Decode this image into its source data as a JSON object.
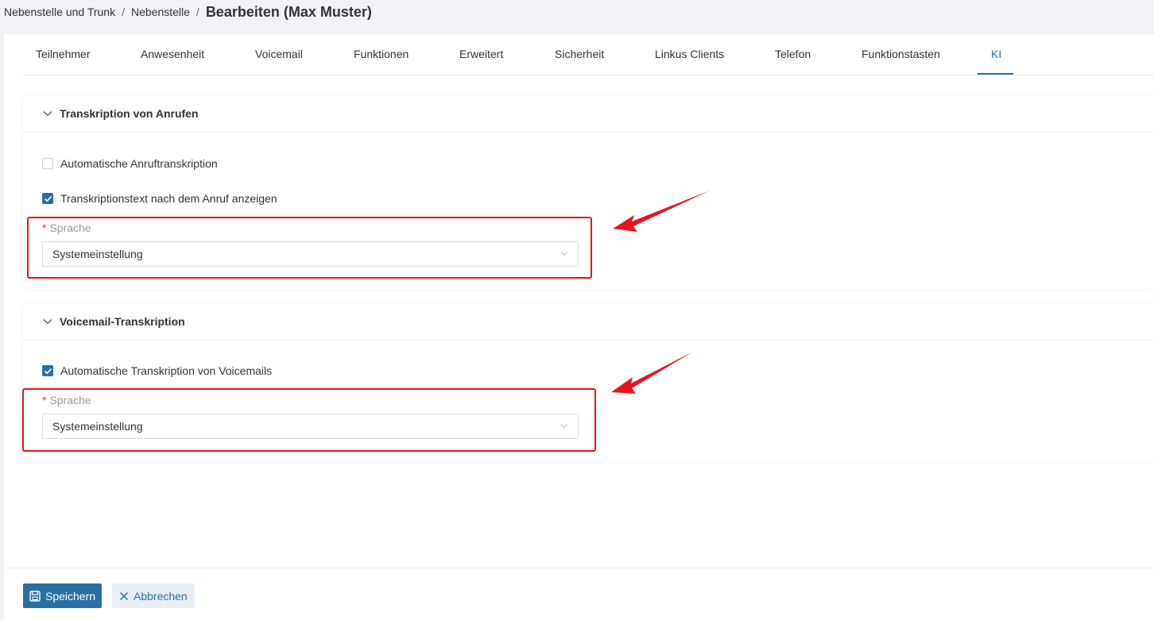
{
  "breadcrumb": {
    "items": [
      "Nebenstelle und Trunk",
      "Nebenstelle"
    ],
    "separator": "/",
    "current": "Bearbeiten (Max Muster)"
  },
  "tabs": [
    {
      "label": "Teilnehmer",
      "active": false
    },
    {
      "label": "Anwesenheit",
      "active": false
    },
    {
      "label": "Voicemail",
      "active": false
    },
    {
      "label": "Funktionen",
      "active": false
    },
    {
      "label": "Erweitert",
      "active": false
    },
    {
      "label": "Sicherheit",
      "active": false
    },
    {
      "label": "Linkus Clients",
      "active": false
    },
    {
      "label": "Telefon",
      "active": false
    },
    {
      "label": "Funktionstasten",
      "active": false
    },
    {
      "label": "KI",
      "active": true
    }
  ],
  "call_transcription": {
    "title": "Transkription von Anrufen",
    "auto_label": "Automatische Anruftranskription",
    "auto_checked": false,
    "show_text_label": "Transkriptionstext nach dem Anruf anzeigen",
    "show_text_checked": true,
    "required_mark": "*",
    "language_label": "Sprache",
    "language_value": "Systemeinstellung"
  },
  "voicemail_transcription": {
    "title": "Voicemail-Transkription",
    "auto_label": "Automatische Transkription von Voicemails",
    "auto_checked": true,
    "required_mark": "*",
    "language_label": "Sprache",
    "language_value": "Systemeinstellung"
  },
  "footer": {
    "save_label": "Speichern",
    "cancel_label": "Abbrechen"
  },
  "colors": {
    "accent": "#2a6fa3",
    "annotation": "#e8141c",
    "required": "#e4393c"
  }
}
